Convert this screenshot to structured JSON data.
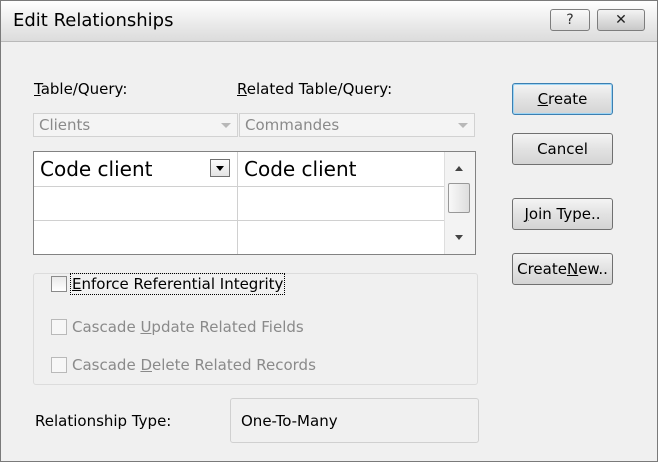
{
  "window": {
    "title": "Edit Relationships",
    "help_glyph": "?",
    "close_glyph": "✕"
  },
  "labels": {
    "table_query": {
      "mnemonic": "T",
      "rest": "able/Query:"
    },
    "related_table_query": {
      "mnemonic": "R",
      "rest": "elated Table/Query:"
    }
  },
  "combos": {
    "table": {
      "value": "Clients"
    },
    "related": {
      "value": "Commandes"
    }
  },
  "fields_grid": {
    "rows": [
      {
        "left": "Code client",
        "right": "Code client"
      },
      {
        "left": "",
        "right": ""
      },
      {
        "left": "",
        "right": ""
      }
    ]
  },
  "checkboxes": {
    "enforce": {
      "mnemonic": "E",
      "rest": "nforce Referential Integrity",
      "checked": false,
      "enabled": true
    },
    "cascade_update": {
      "before": "Cascade ",
      "mnemonic": "U",
      "rest": "pdate Related Fields",
      "checked": false,
      "enabled": false
    },
    "cascade_delete": {
      "before": "Cascade ",
      "mnemonic": "D",
      "rest": "elete Related Records",
      "checked": false,
      "enabled": false
    }
  },
  "relationship": {
    "label": "Relationship Type:",
    "value": "One-To-Many"
  },
  "buttons": {
    "create": {
      "mnemonic": "C",
      "rest": "reate"
    },
    "cancel": {
      "label": "Cancel"
    },
    "join_type": {
      "mnemonic": "J",
      "rest": "oin Type.."
    },
    "create_new": {
      "before": "Create ",
      "mnemonic": "N",
      "rest": "ew.."
    }
  },
  "colors": {
    "dialog_bg": "#f0f0f0",
    "disabled_text": "#8a8a8a",
    "default_button_border": "#3c7fb1"
  }
}
